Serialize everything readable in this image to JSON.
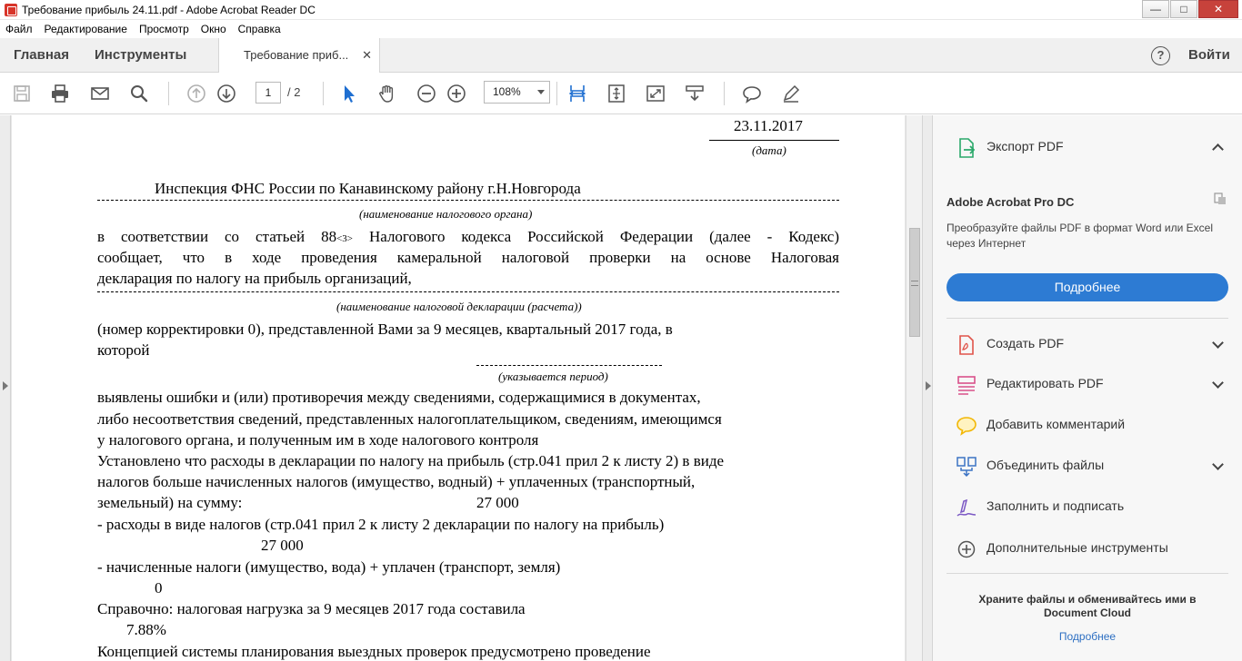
{
  "window": {
    "title": "Требование прибыль 24.11.pdf - Adobe Acrobat Reader DC",
    "minimize": "—",
    "maximize": "□",
    "close": "✕"
  },
  "menu": [
    "Файл",
    "Редактирование",
    "Просмотр",
    "Окно",
    "Справка"
  ],
  "tabs": {
    "home": "Главная",
    "tools": "Инструменты",
    "document": "Требование приб...",
    "close_glyph": "✕",
    "help_glyph": "?",
    "signin": "Войти"
  },
  "toolbar": {
    "page_current": "1",
    "page_total": "/ 2",
    "zoom": "108%",
    "icons": [
      "save-icon",
      "print-icon",
      "email-icon",
      "search-icon",
      "page-up-icon",
      "page-down-icon",
      "select-cursor-icon",
      "hand-icon",
      "zoom-out-icon",
      "zoom-in-icon",
      "fit-width-icon",
      "fit-page-icon",
      "full-screen-icon",
      "read-mode-icon",
      "comment-icon",
      "highlight-pen-icon"
    ]
  },
  "document": {
    "date": "23.11.2017",
    "date_caption": "(дата)",
    "authority": "Инспекция ФНС России по Канавинскому району г.Н.Новгорода",
    "authority_caption": "(наименование налогового органа)",
    "para1_line1_a": "в соответствии со статьей 88",
    "para1_line1_sup": "<3>",
    "para1_line1_b": " Налогового кодекса Российской Федерации (далее - Кодекс)",
    "para1_line2": "сообщает, что в ходе проведения камеральной налоговой проверки на основе Налоговая",
    "para1_line3": "декларация по налогу на прибыль организаций,",
    "declaration_caption": "(наименование налоговой декларации (расчета))",
    "para2_line1": "(номер корректировки 0), представленной Вами  за 9 месяцев, квартальный  2017 года, в",
    "para2_line2": "которой",
    "period_caption": "(указывается период)",
    "para3_line1": "выявлены ошибки и (или) противоречия между сведениями, содержащимися в документах,",
    "para3_line2": "либо несоответствия сведений, представленных налогоплательщиком, сведениям, имеющимся",
    "para3_line3": "у налогового органа, и полученным им в ходе налогового контроля",
    "para4_line1": "Установлено что расходы в декларации по налогу на прибыль (стр.041 прил 2 к листу 2) в виде",
    "para4_line2": "налогов  больше начисленных налогов (имущество, водный) + уплаченных (транспортный,",
    "para4_line3": "земельный) на сумму:",
    "amount1": "27 000",
    "para5": "- расходы в виде налогов (стр.041 прил 2 к листу 2 декларации по налогу на прибыль)",
    "amount2": "27 000",
    "para6": "- начисленные налоги (имущество, вода) + уплачен (транспорт, земля)",
    "amount3": "0",
    "para7": "Справочно: налоговая нагрузка за 9 месяцев 2017 года составила",
    "amount4": "7.88%",
    "para8": "Концепцией системы планирования выездных проверок предусмотрено проведение"
  },
  "panel": {
    "export_pdf": "Экспорт PDF",
    "promo_title": "Adobe Acrobat Pro DC",
    "promo_desc": "Преобразуйте файлы PDF в формат Word или Excel через Интернет",
    "promo_button": "Подробнее",
    "tools": [
      {
        "label": "Создать PDF",
        "icon": "create-pdf-icon",
        "expandable": true
      },
      {
        "label": "Редактировать PDF",
        "icon": "edit-pdf-icon",
        "expandable": true
      },
      {
        "label": "Добавить комментарий",
        "icon": "comment-icon",
        "expandable": false
      },
      {
        "label": "Объединить файлы",
        "icon": "combine-files-icon",
        "expandable": true
      },
      {
        "label": "Заполнить и подписать",
        "icon": "fill-sign-icon",
        "expandable": false
      },
      {
        "label": "Дополнительные инструменты",
        "icon": "more-tools-icon",
        "expandable": false
      }
    ],
    "cloud_text": "Храните файлы и обменивайтесь ими в Document Cloud",
    "cloud_link": "Подробнее"
  },
  "colors": {
    "accent_blue": "#2d7bd3",
    "link_blue": "#2d6fc2",
    "active_tool_blue": "#1f6fd1",
    "export_green": "#2aa86a",
    "create_red": "#e0544a",
    "edit_pink": "#d9508a",
    "comment_yellow": "#f2b705",
    "combine_blue": "#3b73c4",
    "sign_purple": "#7b58c4"
  }
}
